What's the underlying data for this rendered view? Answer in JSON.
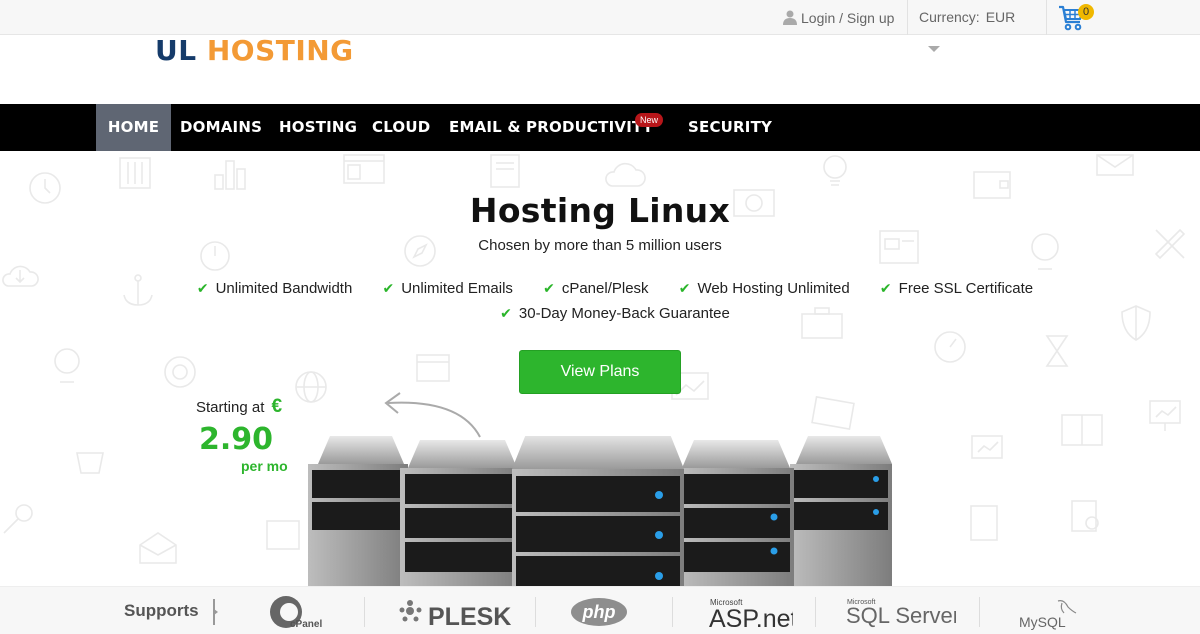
{
  "topbar": {
    "login_label": "Login / Sign up",
    "currency_label": "Currency:",
    "currency_value": "EUR",
    "cart_count": "0",
    "icons": {
      "user": "user-icon",
      "cart": "cart-icon"
    }
  },
  "logo": {
    "part1": "UL",
    "part2": "HOSTING"
  },
  "nav": {
    "items": [
      {
        "label": "HOME",
        "active": true
      },
      {
        "label": "DOMAINS"
      },
      {
        "label": "HOSTING"
      },
      {
        "label": "CLOUD"
      },
      {
        "label": "EMAIL & PRODUCTIVITY",
        "badge": "New"
      },
      {
        "label": "SECURITY"
      }
    ]
  },
  "hero": {
    "title": "Hosting Linux",
    "subtitle": "Chosen by more than 5 million users",
    "features": [
      "Unlimited Bandwidth",
      "Unlimited Emails",
      "cPanel/Plesk",
      "Web Hosting Unlimited",
      "Free SSL Certificate",
      "30-Day Money-Back Guarantee"
    ],
    "check_icon": "✔",
    "cta_label": "View Plans",
    "starting_label": "Starting at",
    "currency_symbol": "€",
    "price": "2.90",
    "per_label": "per mo"
  },
  "supports": {
    "label": "Supports",
    "logos": [
      "cPanel",
      "PLESK",
      "php",
      "ASP.net",
      "SQL Server",
      "MySQL"
    ],
    "microsoft_label": "Microsoft"
  },
  "colors": {
    "brand_dark": "#153b6a",
    "brand_orange": "#f39a35",
    "accent_green": "#2db52d",
    "nav_bg": "#000000",
    "nav_active": "#5f6673",
    "new_badge": "#b7161a",
    "cart_blue": "#2a7fd4",
    "cart_badge": "#f0b800"
  }
}
